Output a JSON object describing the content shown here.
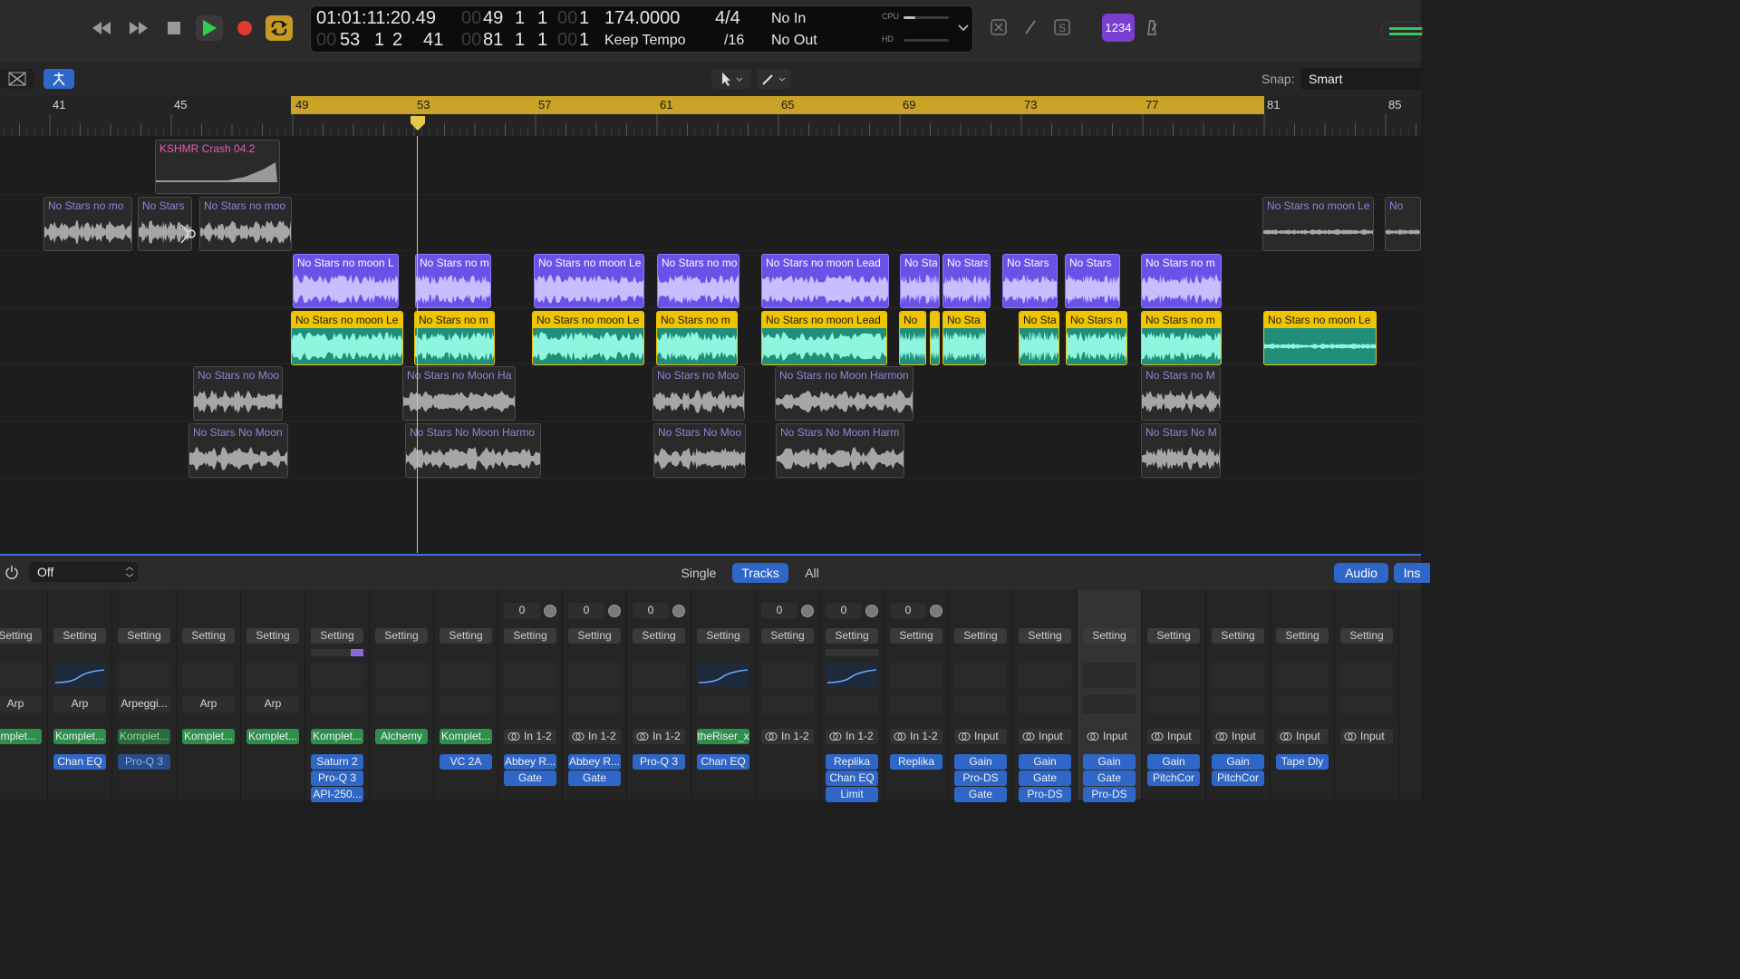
{
  "control_bar": {
    "time": "01:01:11:20.49",
    "bars_pos": [
      "49",
      "1",
      "1"
    ],
    "bars_pos_dim": "00",
    "bars_pos_tick_dim": "00",
    "bars_pos_tick": "1",
    "tempo": "174.0000",
    "signature": "4/4",
    "in": "No In",
    "row2_pos_dim": "00",
    "row2_pos": [
      "53",
      "1",
      "2",
      "41"
    ],
    "row2_len_dim": "00",
    "row2_len": [
      "81",
      "1",
      "1"
    ],
    "row2_len_tick_dim": "00",
    "row2_len_tick": "1",
    "tempo_mode": "Keep Tempo",
    "division": "/16",
    "out": "No Out",
    "cpu_label": "CPU",
    "hd_label": "HD",
    "cpu_level": 0.25,
    "count_in_label": "1234",
    "accent": "#7a3fd0"
  },
  "toolbar": {
    "snap_label": "Snap:",
    "snap_value": "Smart"
  },
  "ruler": {
    "bars": [
      "41",
      "45",
      "49",
      "53",
      "57",
      "61",
      "65",
      "69",
      "73",
      "77",
      "81",
      "85"
    ],
    "cycle_color": "#c9a227"
  },
  "regions": {
    "crash": "KSHMR Crash 04.2",
    "lane2": [
      "No Stars no mo",
      "No Stars",
      "No Stars no moo",
      "No Stars no moon Le",
      "No"
    ],
    "lane3": [
      "No Stars no moon L",
      "No Stars no m",
      "No Stars no moon Le",
      "No Stars no mo",
      "No Stars no moon Lead",
      "No Sta",
      "No Stars",
      "No Stars",
      "No Stars",
      "No Stars no m"
    ],
    "lane4": [
      "No Stars no moon Le",
      "No Stars no m",
      "No Stars no moon Le",
      "No Stars no m",
      "No Stars no moon Lead",
      "No",
      "No Sta",
      "No Sta",
      "No Stars n",
      "No Stars no m",
      "No Stars no moon Le"
    ],
    "lane5": [
      "No Stars no Moo",
      "No Stars no Moon Ha",
      "No Stars no Moo",
      "No Stars no Moon Harmon",
      "No Stars no M"
    ],
    "lane6": [
      "No Stars No Moon",
      "No Stars No Moon Harmo",
      "No Stars No Moo",
      "No Stars No Moon Harm",
      "No Stars No M"
    ]
  },
  "mixer_bar": {
    "power_label": "Off",
    "views": [
      "Single",
      "Tracks",
      "All"
    ],
    "active_view": "Tracks",
    "right_buttons": [
      "Audio",
      "Ins"
    ]
  },
  "mixer": {
    "setting_label": "Setting",
    "pan_values": [
      "0",
      "0",
      "0",
      "0",
      "0",
      "0"
    ],
    "midi_fx": [
      "Arp",
      "Arp",
      "Arpeggi...",
      "Arp",
      "Arp"
    ],
    "inputs": [
      "omplet...",
      "Komplet...",
      "Komplet...",
      "Komplet...",
      "Komplet...",
      "Komplet...",
      "Alchemy",
      "Komplet...",
      "In 1-2",
      "In 1-2",
      "In 1-2",
      "theRiser_x",
      "In 1-2",
      "In 1-2",
      "In 1-2",
      "Input",
      "Input",
      "Input",
      "Input",
      "Input",
      "Input",
      "Input"
    ],
    "inserts": [
      [],
      [
        "Chan EQ"
      ],
      [
        "Pro-Q 3"
      ],
      [],
      [],
      [
        "Saturn 2",
        "Pro-Q 3",
        "API-250..."
      ],
      [],
      [
        "VC 2A"
      ],
      [
        "Abbey R...",
        "Gate"
      ],
      [
        "Abbey R...",
        "Gate"
      ],
      [
        "Pro-Q 3"
      ],
      [
        "Chan EQ"
      ],
      [],
      [
        "Replika",
        "Chan EQ",
        "Limit"
      ],
      [
        "Replika"
      ],
      [
        "Gain",
        "Pro-DS",
        "Gate"
      ],
      [
        "Gain",
        "Gate",
        "Pro-DS"
      ],
      [
        "Gain",
        "Gate",
        "Pro-DS"
      ],
      [
        "Gain",
        "PitchCor"
      ],
      [
        "Gain",
        "PitchCor"
      ],
      [
        "Tape Dly"
      ],
      []
    ]
  }
}
